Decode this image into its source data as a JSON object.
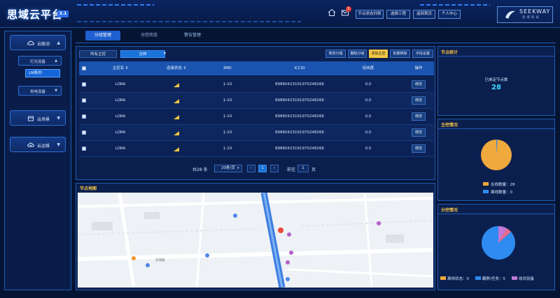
{
  "header": {
    "title": "思域云平台",
    "version": "3.1",
    "message_count": "5",
    "buttons": [
      "节点状态列表",
      "选择工程",
      "返回首页",
      "个人中心"
    ],
    "brand": "SEEKWAY",
    "brand_sub": "思域科技"
  },
  "sidebar": {
    "items": [
      {
        "label": "云联动"
      },
      {
        "label": "云场景"
      },
      {
        "label": "云运维"
      }
    ],
    "sub_items": [
      "灯光设备",
      "用电设备"
    ],
    "leaf_selected": "LM系列"
  },
  "tabs": [
    "分组管理",
    "分控状态",
    "警告管理"
  ],
  "filters": {
    "all": "所有主控",
    "selected": "吉林"
  },
  "ops": [
    "修改分组",
    "删除分组",
    "添加主控",
    "批量移除",
    "字段设置"
  ],
  "table": {
    "headers": [
      "主控名 ⇕",
      "连接状态 ⇕",
      "IMEI",
      "ICCID",
      "经纬度",
      "操作"
    ],
    "rows": [
      {
        "name": "LORA",
        "imei": "1-10",
        "iccid": "89860423191970248266",
        "coord": "0,0",
        "action": "修改"
      },
      {
        "name": "LORA",
        "imei": "1-10",
        "iccid": "89860423191970248266",
        "coord": "0,0",
        "action": "修改"
      },
      {
        "name": "LORA",
        "imei": "1-10",
        "iccid": "89860423191970248266",
        "coord": "0,0",
        "action": "修改"
      },
      {
        "name": "LORA",
        "imei": "1-10",
        "iccid": "89860423191970248266",
        "coord": "0,0",
        "action": "修改"
      },
      {
        "name": "LORA",
        "imei": "1-10",
        "iccid": "89860423191970248266",
        "coord": "0,0",
        "action": "修改"
      }
    ]
  },
  "pager": {
    "total": "共28 条",
    "page_size": "20条/页",
    "current": "1",
    "goto_label": "前往",
    "goto_value": "1",
    "page_unit": "页"
  },
  "map": {
    "title": "节点地图",
    "road_label": "滨海路"
  },
  "node_stats": {
    "title": "节点统计",
    "label": "已绑定节点数",
    "value": "28"
  },
  "control_status": {
    "title": "主控情况",
    "legend": [
      {
        "label": "在线数量：28",
        "color": "#f0a93c"
      },
      {
        "label": "离线数量：0",
        "color": "#2e8bf0"
      }
    ]
  },
  "dist_status": {
    "title": "分控情况",
    "legend": [
      {
        "label": "离线状态：0",
        "color": "#f0a93c"
      },
      {
        "label": "翻屏/任务：5",
        "color": "#2e8bf0"
      },
      {
        "label": "收到设备",
        "color": "#c178d8"
      }
    ]
  },
  "colors": {
    "accent": "#1f5fd0",
    "highlight": "#f2c744",
    "title_gold": "#f3c14b"
  }
}
